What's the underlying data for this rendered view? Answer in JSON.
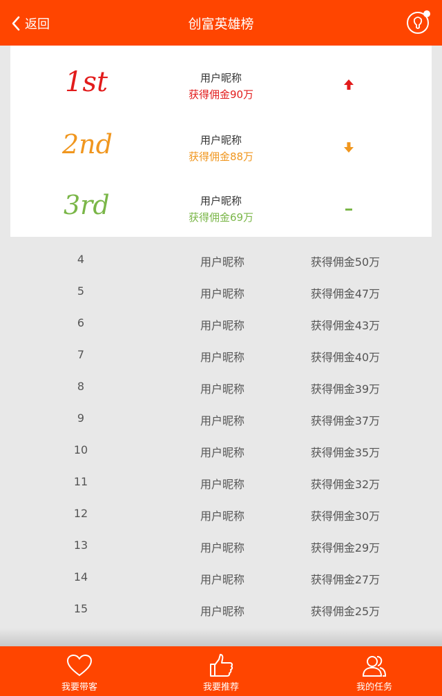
{
  "header": {
    "back_label": "返回",
    "title": "创富英雄榜"
  },
  "colors": {
    "brand": "#ff4500",
    "first": "#e21b1b",
    "second": "#f0961e",
    "third": "#7ab648"
  },
  "top3": [
    {
      "rank_text": "1st",
      "name": "用户昵称",
      "commission": "获得佣金90万",
      "trend": "up",
      "color": "#e21b1b"
    },
    {
      "rank_text": "2nd",
      "name": "用户昵称",
      "commission": "获得佣金88万",
      "trend": "down",
      "color": "#f0961e"
    },
    {
      "rank_text": "3rd",
      "name": "用户昵称",
      "commission": "获得佣金69万",
      "trend": "flat",
      "color": "#7ab648"
    }
  ],
  "list": [
    {
      "rank": "4",
      "name": "用户昵称",
      "commission": "获得佣金50万"
    },
    {
      "rank": "5",
      "name": "用户昵称",
      "commission": "获得佣金47万"
    },
    {
      "rank": "6",
      "name": "用户昵称",
      "commission": "获得佣金43万"
    },
    {
      "rank": "7",
      "name": "用户昵称",
      "commission": "获得佣金40万"
    },
    {
      "rank": "8",
      "name": "用户昵称",
      "commission": "获得佣金39万"
    },
    {
      "rank": "9",
      "name": "用户昵称",
      "commission": "获得佣金37万"
    },
    {
      "rank": "10",
      "name": "用户昵称",
      "commission": "获得佣金35万"
    },
    {
      "rank": "11",
      "name": "用户昵称",
      "commission": "获得佣金32万"
    },
    {
      "rank": "12",
      "name": "用户昵称",
      "commission": "获得佣金30万"
    },
    {
      "rank": "13",
      "name": "用户昵称",
      "commission": "获得佣金29万"
    },
    {
      "rank": "14",
      "name": "用户昵称",
      "commission": "获得佣金27万"
    },
    {
      "rank": "15",
      "name": "用户昵称",
      "commission": "获得佣金25万"
    }
  ],
  "tabs": [
    {
      "label": "我要带客",
      "icon": "heart-icon"
    },
    {
      "label": "我要推荐",
      "icon": "thumbs-up-icon"
    },
    {
      "label": "我的任务",
      "icon": "users-icon"
    }
  ]
}
